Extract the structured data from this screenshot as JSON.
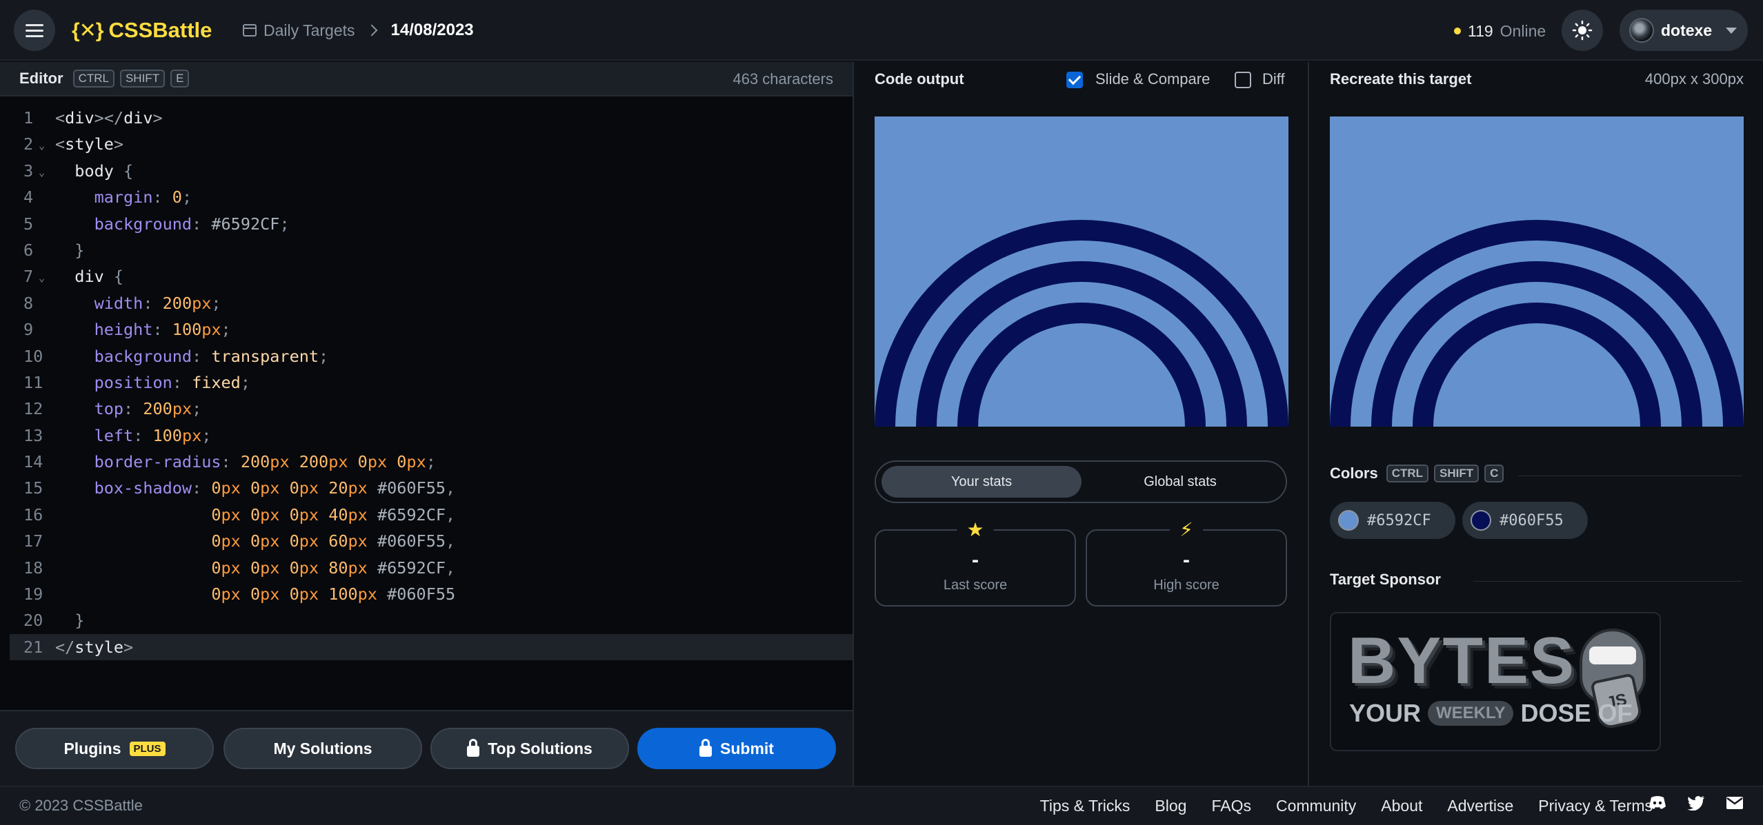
{
  "topbar": {
    "logo_mark": "{✕}",
    "logo_text": "CSSBattle",
    "breadcrumb_section": "Daily Targets",
    "breadcrumb_date": "14/08/2023",
    "online_count": "119",
    "online_label": "Online",
    "username": "dotexe"
  },
  "editor": {
    "title": "Editor",
    "shortcut": [
      "CTRL",
      "SHIFT",
      "E"
    ],
    "char_count": "463 characters",
    "lines": [
      {
        "n": "1"
      },
      {
        "n": "2"
      },
      {
        "n": "3"
      },
      {
        "n": "4"
      },
      {
        "n": "5"
      },
      {
        "n": "6"
      },
      {
        "n": "7"
      },
      {
        "n": "8"
      },
      {
        "n": "9"
      },
      {
        "n": "10"
      },
      {
        "n": "11"
      },
      {
        "n": "12"
      },
      {
        "n": "13"
      },
      {
        "n": "14"
      },
      {
        "n": "15"
      },
      {
        "n": "16"
      },
      {
        "n": "17"
      },
      {
        "n": "18"
      },
      {
        "n": "19"
      },
      {
        "n": "20"
      },
      {
        "n": "21"
      }
    ]
  },
  "actions": {
    "plugins": "Plugins",
    "plugins_badge": "PLUS",
    "my_solutions": "My Solutions",
    "top_solutions": "Top Solutions",
    "submit": "Submit"
  },
  "output": {
    "title": "Code output",
    "slide_compare": "Slide & Compare",
    "slide_compare_checked": true,
    "diff": "Diff",
    "diff_checked": false,
    "stats_tabs": [
      "Your stats",
      "Global stats"
    ],
    "last_score_value": "-",
    "last_score_label": "Last score",
    "high_score_value": "-",
    "high_score_label": "High score"
  },
  "target": {
    "title": "Recreate this target",
    "size": "400px x 300px",
    "colors_label": "Colors",
    "colors_shortcut": [
      "CTRL",
      "SHIFT",
      "C"
    ],
    "colors": [
      "#6592CF",
      "#060F55"
    ],
    "sponsor_label": "Target Sponsor",
    "sponsor_big": "BYTES",
    "sponsor_your": "YOUR",
    "sponsor_weekly": "WEEKLY",
    "sponsor_dose": "DOSE OF",
    "sponsor_js": "JS"
  },
  "palette": {
    "background": "#6592CF",
    "ring": "#060F55",
    "accent": "#ffdd40",
    "primary": "#0a66d6"
  },
  "footer": {
    "copyright": "© 2023 CSSBattle",
    "links": [
      "Tips & Tricks",
      "Blog",
      "FAQs",
      "Community",
      "About",
      "Advertise",
      "Privacy & Terms"
    ]
  }
}
